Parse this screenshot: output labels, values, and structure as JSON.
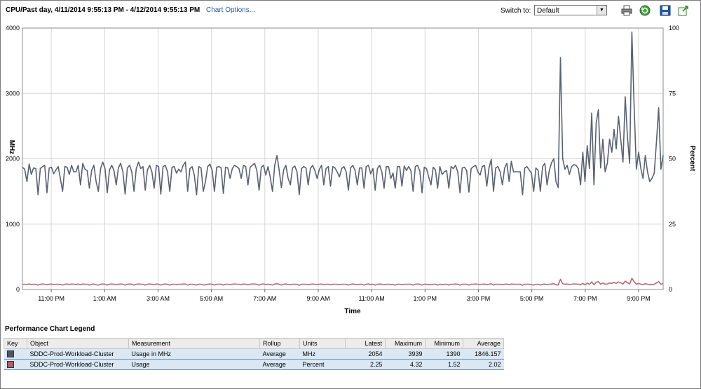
{
  "header": {
    "title": "CPU/Past day, 4/11/2014 9:55:13 PM - 4/12/2014 9:55:13 PM",
    "chart_options_label": "Chart Options...",
    "switch_label": "Switch to:",
    "switch_value": "Default",
    "icons": [
      "print-icon",
      "refresh-icon",
      "save-icon",
      "popout-icon"
    ]
  },
  "chart_data": {
    "type": "line",
    "xlabel": "Time",
    "ylabel_left": "MHz",
    "ylabel_right": "Percent",
    "y_left_ticks": [
      "4000",
      "3000",
      "2000",
      "1000",
      "0"
    ],
    "y_right_ticks": [
      "100",
      "75",
      "50",
      "25",
      "0"
    ],
    "ylim_left": [
      0,
      4000
    ],
    "ylim_right": [
      0,
      100
    ],
    "x_ticks": [
      "11:00 PM",
      "1:00 AM",
      "3:00 AM",
      "5:00 AM",
      "7:00 AM",
      "9:00 AM",
      "11:00 AM",
      "1:00 PM",
      "3:00 PM",
      "5:00 PM",
      "7:00 PM",
      "9:00 PM"
    ],
    "grid": true,
    "series": [
      {
        "name": "Usage in MHz",
        "axis": "left",
        "color": "#5a6172",
        "values": [
          1870,
          1840,
          1650,
          1920,
          1760,
          1860,
          1850,
          1450,
          1850,
          1880,
          1900,
          1480,
          1860,
          1870,
          1770,
          1830,
          1880,
          1700,
          1500,
          1880,
          1870,
          1760,
          1900,
          1800,
          1800,
          1900,
          1600,
          1930,
          1840,
          1820,
          1550,
          1820,
          1900,
          1650,
          1500,
          1850,
          1950,
          1850,
          1480,
          1830,
          1900,
          1820,
          1600,
          1860,
          1930,
          1800,
          1460,
          1860,
          1900,
          1800,
          1500,
          1850,
          1950,
          1850,
          1880,
          1520,
          1830,
          1900,
          1800,
          1550,
          1900,
          1880,
          1460,
          1880,
          1900,
          1800,
          1500,
          1870,
          1880,
          1780,
          1840,
          1800,
          1900,
          1950,
          1500,
          1850,
          1880,
          1750,
          1450,
          1880,
          1860,
          1500,
          1650,
          1880,
          1920,
          1820,
          1500,
          1870,
          1880,
          1860,
          1470,
          1870,
          1860,
          1700,
          1850,
          1900,
          1880,
          1850,
          1700,
          1900,
          1880,
          1600,
          1870,
          1900,
          1930,
          1820,
          1520,
          1870,
          1900,
          1750,
          1880,
          1720,
          1500,
          1900,
          2050,
          1830,
          1560,
          1830,
          1900,
          1700,
          1600,
          1860,
          1890,
          1800,
          1450,
          1850,
          1880,
          1860,
          1600,
          1850,
          1900,
          1820,
          1700,
          1840,
          1900,
          1600,
          1850,
          1880,
          1580,
          1880,
          1860,
          1800,
          1720,
          1850,
          1880,
          1800,
          1520,
          1860,
          1900,
          1820,
          1600,
          1860,
          1860,
          1550,
          1880,
          1900,
          1770,
          1850,
          1520,
          1850,
          1900,
          1800,
          1550,
          1880,
          1880,
          1700,
          1780,
          1550,
          1880,
          1880,
          1580,
          1890,
          1820,
          1880,
          1820,
          1500,
          1880,
          1900,
          1810,
          1480,
          1870,
          1850,
          1720,
          1600,
          1870,
          1830,
          1550,
          1880,
          1760,
          1800,
          1820,
          1550,
          1880,
          1850,
          1900,
          1800,
          1480,
          1860,
          1870,
          1820,
          1490,
          1850,
          1880,
          1900,
          1800,
          1750,
          1880,
          1900,
          1580,
          1860,
          1990,
          1500,
          1860,
          1880,
          1800,
          1600,
          1860,
          1930,
          1650,
          1960,
          1800,
          1800,
          1800,
          1800,
          1450,
          1860,
          1880,
          1830,
          1780,
          1500,
          1860,
          1820,
          1500,
          1880,
          1930,
          1600,
          1820,
          1940,
          2000,
          1650,
          1560,
          3550,
          2000,
          1840,
          1900,
          1760,
          1880,
          1910,
          1900,
          1850,
          1600,
          2100,
          1650,
          2200,
          1850,
          2700,
          1600,
          2550,
          2750,
          1860,
          2300,
          1800,
          1930,
          2300,
          2100,
          2450,
          2150,
          2650,
          2300,
          1950,
          2950,
          2350,
          1930,
          3939,
          2800,
          1840,
          2100,
          1850,
          1700,
          2050,
          1800,
          1650,
          1700,
          1780,
          2250,
          2780,
          1840,
          2054
        ]
      },
      {
        "name": "Usage",
        "axis": "right",
        "color": "#b56a72",
        "values": [
          2.0,
          2.0,
          1.9,
          2.1,
          1.9,
          2.0,
          2.0,
          1.7,
          2.0,
          2.1,
          2.0,
          1.8,
          2.0,
          2.1,
          1.9,
          2.0,
          2.0,
          1.9,
          1.7,
          2.0,
          2.1,
          1.9,
          2.1,
          2.0,
          1.9,
          2.1,
          1.8,
          2.1,
          2.0,
          2.0,
          1.7,
          2.0,
          2.1,
          1.8,
          1.7,
          2.0,
          2.1,
          2.0,
          1.7,
          2.0,
          2.1,
          2.0,
          1.8,
          2.0,
          2.1,
          2.0,
          1.7,
          2.0,
          2.1,
          2.0,
          1.7,
          2.0,
          2.1,
          2.0,
          2.0,
          1.7,
          2.0,
          2.1,
          2.0,
          1.8,
          2.1,
          2.0,
          1.7,
          2.0,
          2.1,
          2.0,
          1.7,
          2.0,
          2.0,
          1.9,
          2.0,
          2.0,
          2.1,
          2.1,
          1.7,
          2.0,
          2.0,
          1.9,
          1.7,
          2.0,
          2.0,
          1.7,
          1.8,
          2.0,
          2.1,
          2.0,
          1.7,
          2.0,
          2.0,
          2.0,
          1.7,
          2.0,
          2.0,
          1.9,
          2.0,
          2.1,
          2.0,
          2.0,
          1.9,
          2.1,
          2.0,
          1.8,
          2.0,
          2.1,
          2.1,
          2.0,
          1.7,
          2.0,
          2.1,
          1.9,
          2.0,
          1.9,
          1.7,
          2.1,
          2.2,
          2.0,
          1.7,
          2.0,
          2.1,
          1.9,
          1.8,
          2.0,
          2.0,
          2.0,
          1.6,
          2.0,
          2.0,
          2.0,
          1.8,
          2.0,
          2.1,
          2.0,
          1.9,
          2.0,
          2.1,
          1.8,
          2.0,
          2.0,
          1.8,
          2.0,
          2.0,
          2.0,
          1.9,
          2.0,
          2.0,
          2.0,
          1.7,
          2.0,
          2.1,
          2.0,
          1.8,
          2.0,
          2.0,
          1.7,
          2.0,
          2.1,
          1.9,
          2.0,
          1.7,
          2.0,
          2.1,
          2.0,
          1.8,
          2.0,
          2.0,
          1.9,
          1.9,
          1.7,
          2.0,
          2.0,
          1.8,
          2.0,
          2.0,
          2.0,
          2.0,
          1.7,
          2.0,
          2.1,
          2.0,
          1.7,
          2.0,
          2.0,
          1.9,
          1.8,
          2.0,
          2.0,
          1.7,
          2.0,
          1.9,
          2.0,
          2.0,
          1.7,
          2.0,
          2.0,
          2.1,
          2.0,
          1.7,
          2.0,
          2.0,
          2.0,
          1.7,
          2.0,
          2.0,
          2.1,
          2.0,
          1.9,
          2.0,
          2.1,
          1.8,
          2.0,
          2.2,
          1.7,
          2.0,
          2.0,
          2.0,
          1.8,
          2.0,
          2.1,
          1.8,
          2.1,
          2.0,
          2.0,
          2.0,
          2.0,
          1.6,
          2.0,
          2.0,
          2.0,
          1.9,
          1.7,
          2.0,
          2.0,
          1.7,
          2.0,
          2.1,
          1.8,
          2.0,
          2.1,
          2.2,
          1.8,
          1.7,
          3.9,
          2.2,
          2.0,
          2.1,
          1.9,
          2.0,
          2.1,
          2.1,
          2.0,
          1.8,
          2.3,
          1.8,
          2.4,
          2.0,
          2.9,
          1.8,
          2.8,
          3.0,
          2.0,
          2.5,
          2.0,
          2.1,
          2.5,
          2.3,
          2.7,
          2.3,
          2.9,
          2.5,
          2.1,
          3.2,
          2.6,
          2.1,
          4.3,
          3.0,
          2.0,
          2.3,
          2.0,
          1.9,
          2.2,
          2.0,
          1.8,
          1.9,
          2.0,
          2.5,
          3.0,
          2.0,
          2.25
        ]
      }
    ]
  },
  "legend": {
    "title": "Performance Chart Legend",
    "columns": [
      "Key",
      "Object",
      "Measurement",
      "Rollup",
      "Units",
      "Latest",
      "Maximum",
      "Minimum",
      "Average"
    ],
    "rows": [
      {
        "key_color": "#4d5566",
        "object": "SDDC-Prod-Workload-Cluster",
        "measurement": "Usage in MHz",
        "rollup": "Average",
        "units": "MHz",
        "latest": "2054",
        "maximum": "3939",
        "minimum": "1390",
        "average": "1846.157"
      },
      {
        "key_color": "#b65e66",
        "object": "SDDC-Prod-Workload-Cluster",
        "measurement": "Usage",
        "rollup": "Average",
        "units": "Percent",
        "latest": "2.25",
        "maximum": "4.32",
        "minimum": "1.52",
        "average": "2.02"
      }
    ]
  }
}
